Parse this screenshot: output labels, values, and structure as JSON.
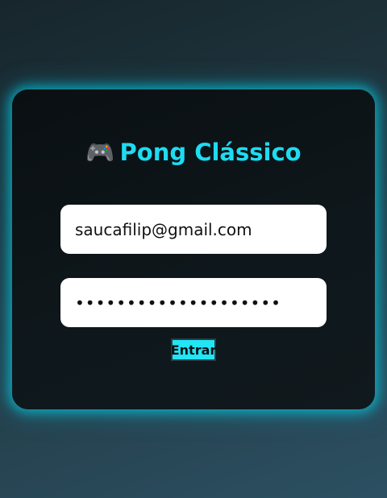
{
  "title": {
    "icon": "🎮",
    "icon_name": "gamepad-icon",
    "text": "Pong Clássico"
  },
  "login": {
    "email_value": "saucafilip@gmail.com",
    "password_value": "••••••••••••••••••••",
    "submit_label": "Entrar"
  },
  "colors": {
    "accent": "#1ddcf2",
    "button": "#22e5f5",
    "card": "#0e171b"
  }
}
